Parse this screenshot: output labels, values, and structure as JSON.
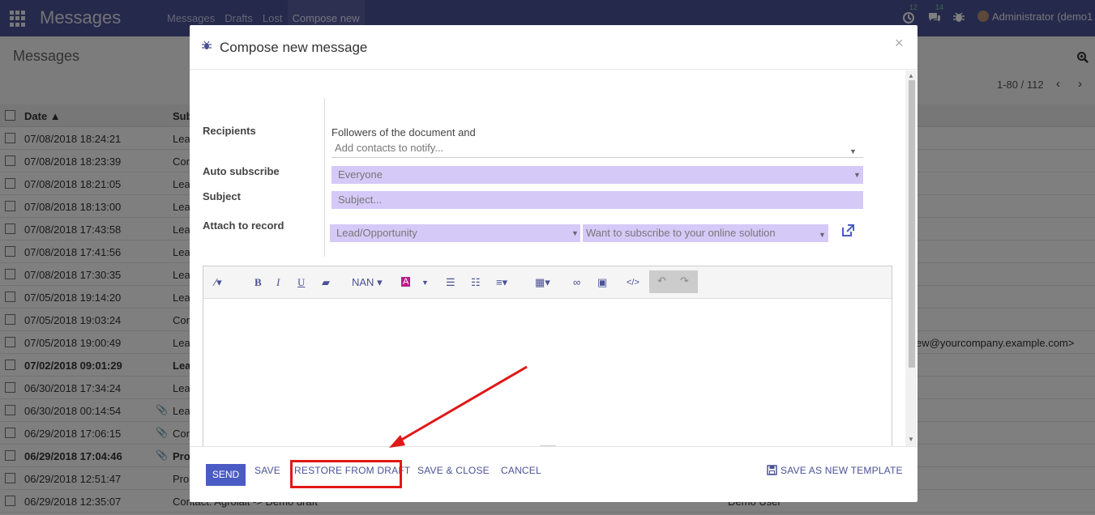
{
  "app": {
    "title": "Messages",
    "menu": [
      "Messages",
      "Drafts",
      "Lost",
      "Compose new"
    ],
    "badges": {
      "activity": "12",
      "chat": "14"
    },
    "user": "Administrator (demo1"
  },
  "list": {
    "page_title": "Messages",
    "pager": "1-80 / 112",
    "columns": {
      "date": "Date ▲",
      "subject": "Sub"
    },
    "rows": [
      {
        "date": "07/08/2018 18:24:21",
        "subject": "Lea",
        "bold": false,
        "clip": false
      },
      {
        "date": "07/08/2018 18:23:39",
        "subject": "Cor",
        "bold": false,
        "clip": false
      },
      {
        "date": "07/08/2018 18:21:05",
        "subject": "Lea",
        "bold": false,
        "clip": false
      },
      {
        "date": "07/08/2018 18:13:00",
        "subject": "Lea",
        "bold": false,
        "clip": false
      },
      {
        "date": "07/08/2018 17:43:58",
        "subject": "Lea",
        "bold": false,
        "clip": false
      },
      {
        "date": "07/08/2018 17:41:56",
        "subject": "Lea",
        "bold": false,
        "clip": false
      },
      {
        "date": "07/08/2018 17:30:35",
        "subject": "Lea",
        "bold": false,
        "clip": false
      },
      {
        "date": "07/05/2018 19:14:20",
        "subject": "Lea",
        "bold": false,
        "clip": false
      },
      {
        "date": "07/05/2018 19:03:24",
        "subject": "Cor",
        "bold": false,
        "clip": false
      },
      {
        "date": "07/05/2018 19:00:49",
        "subject": "Lea",
        "bold": false,
        "clip": false
      },
      {
        "date": "07/02/2018 09:01:29",
        "subject": "Lea",
        "bold": true,
        "clip": false
      },
      {
        "date": "06/30/2018 17:34:24",
        "subject": "Lea",
        "bold": false,
        "clip": false
      },
      {
        "date": "06/30/2018 00:14:54",
        "subject": "Lea",
        "bold": false,
        "clip": true
      },
      {
        "date": "06/29/2018 17:06:15",
        "subject": "Cor",
        "bold": false,
        "clip": true
      },
      {
        "date": "06/29/2018 17:04:46",
        "subject": "Pro",
        "bold": true,
        "clip": true
      },
      {
        "date": "06/29/2018 12:51:47",
        "subject": "Pro",
        "bold": false,
        "clip": false
      },
      {
        "date": "06/29/2018 12:35:07",
        "subject": "Contact: Agrolait -> Demo draft",
        "bold": false,
        "clip": false
      }
    ],
    "extra_email": "ew@yourcompany.example.com>",
    "extra_author": "Demo User"
  },
  "modal": {
    "title": "Compose new message",
    "close": "×",
    "labels": {
      "recipients": "Recipients",
      "auto_subscribe": "Auto subscribe",
      "subject": "Subject",
      "attach": "Attach to record"
    },
    "followers_text": "Followers of the document and",
    "contacts_placeholder": "Add contacts to notify...",
    "auto_subscribe_value": "Everyone",
    "subject_placeholder": "Subject...",
    "model_value": "Lead/Opportunity",
    "record_value": "Want to subscribe to your online solution",
    "toolbar": {
      "font_size": "NAN"
    },
    "buttons": {
      "send": "SEND",
      "save": "SAVE",
      "restore": "RESTORE FROM DRAFT",
      "save_close": "SAVE & CLOSE",
      "cancel": "CANCEL",
      "save_template": "SAVE AS NEW TEMPLATE"
    }
  },
  "colors": {
    "primary": "#4b5296",
    "purple_field": "#d5c9f8",
    "annotation": "#e01818"
  }
}
